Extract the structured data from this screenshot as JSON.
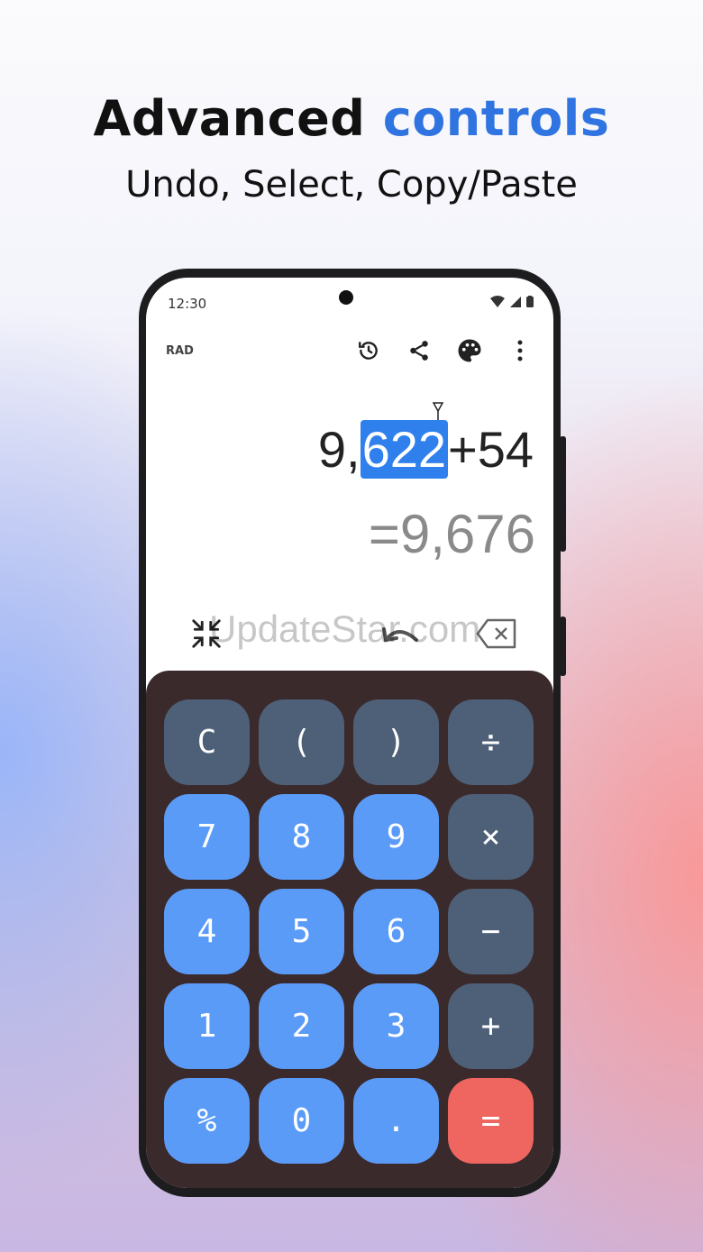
{
  "header": {
    "title_part1": "Advanced",
    "title_part2": "controls",
    "subtitle": "Undo, Select, Copy/Paste"
  },
  "status_bar": {
    "time": "12:30"
  },
  "calculator": {
    "mode": "RAD",
    "toolbar_icons": [
      "history-icon",
      "share-icon",
      "palette-icon",
      "more-vert-icon"
    ],
    "expression_prefix": "9,",
    "expression_selected": "622",
    "expression_suffix": "+54",
    "result": "=9,676",
    "watermark": "UpdateStar.com",
    "controls": [
      "collapse-icon",
      "undo-icon",
      "backspace-icon"
    ],
    "keys": [
      {
        "label": "C",
        "type": "op",
        "name": "clear"
      },
      {
        "label": "(",
        "type": "op",
        "name": "open-paren"
      },
      {
        "label": ")",
        "type": "op",
        "name": "close-paren"
      },
      {
        "label": "÷",
        "type": "op",
        "name": "divide"
      },
      {
        "label": "7",
        "type": "num",
        "name": "seven"
      },
      {
        "label": "8",
        "type": "num",
        "name": "eight"
      },
      {
        "label": "9",
        "type": "num",
        "name": "nine"
      },
      {
        "label": "×",
        "type": "op",
        "name": "multiply"
      },
      {
        "label": "4",
        "type": "num",
        "name": "four"
      },
      {
        "label": "5",
        "type": "num",
        "name": "five"
      },
      {
        "label": "6",
        "type": "num",
        "name": "six"
      },
      {
        "label": "−",
        "type": "op",
        "name": "minus"
      },
      {
        "label": "1",
        "type": "num",
        "name": "one"
      },
      {
        "label": "2",
        "type": "num",
        "name": "two"
      },
      {
        "label": "3",
        "type": "num",
        "name": "three"
      },
      {
        "label": "+",
        "type": "op",
        "name": "plus"
      },
      {
        "label": "%",
        "type": "num",
        "name": "percent"
      },
      {
        "label": "0",
        "type": "num",
        "name": "zero"
      },
      {
        "label": ".",
        "type": "num",
        "name": "decimal"
      },
      {
        "label": "=",
        "type": "eq",
        "name": "equals"
      }
    ]
  },
  "colors": {
    "accent": "#2f74e0",
    "num_key": "#5b9bf8",
    "op_key": "#4d6078",
    "equals_key": "#ef6661",
    "keypad_bg": "#3b2a2b"
  }
}
